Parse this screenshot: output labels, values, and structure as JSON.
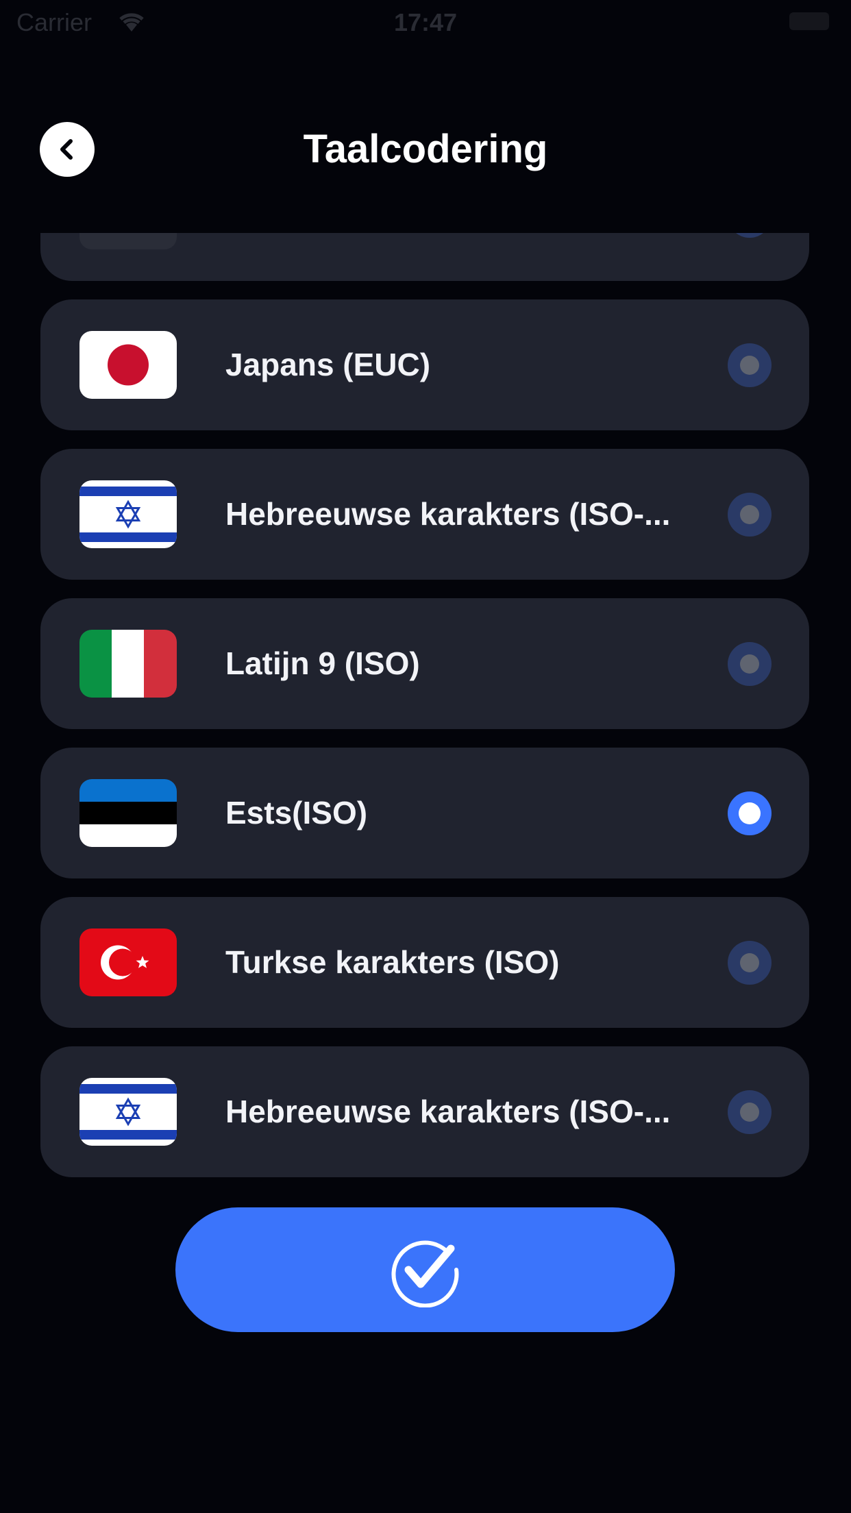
{
  "status_bar": {
    "carrier": "Carrier",
    "time": "17:47"
  },
  "header": {
    "title": "Taalcodering",
    "back_icon": "chevron-left-icon"
  },
  "encodings": [
    {
      "label": "",
      "flag": "unknown",
      "selected": false
    },
    {
      "label": "Japans (EUC)",
      "flag": "japan-flag-icon",
      "selected": false
    },
    {
      "label": "Hebreeuwse karakters (ISO-...",
      "flag": "israel-flag-icon",
      "selected": false
    },
    {
      "label": "Latijn 9 (ISO)",
      "flag": "italy-flag-icon",
      "selected": false
    },
    {
      "label": "Ests(ISO)",
      "flag": "estonia-flag-icon",
      "selected": true
    },
    {
      "label": "Turkse karakters (ISO)",
      "flag": "turkey-flag-icon",
      "selected": false
    },
    {
      "label": "Hebreeuwse karakters (ISO-...",
      "flag": "israel-flag-icon",
      "selected": false
    },
    {
      "label": "",
      "flag": "unknown",
      "selected": false
    }
  ],
  "confirm": {
    "icon": "checkmark-circle-icon"
  },
  "colors": {
    "background": "#03040a",
    "card": "#20232f",
    "accent": "#3b74fb",
    "radio_ring": "#2a3a66",
    "radio_dot": "#5f6470"
  }
}
